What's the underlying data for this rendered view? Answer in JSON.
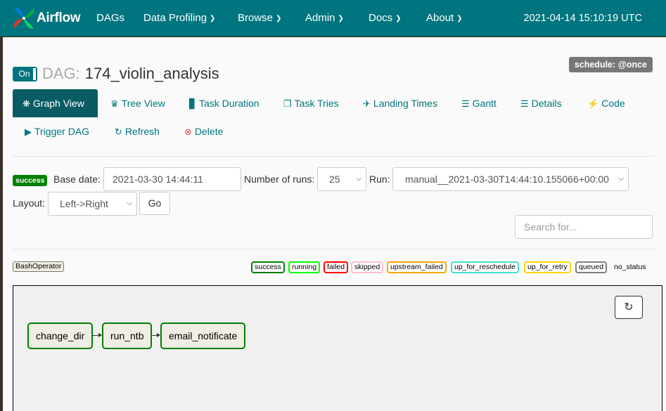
{
  "navbar": {
    "brand": "Airflow",
    "items": [
      {
        "label": "DAGs",
        "dropdown": false
      },
      {
        "label": "Data Profiling",
        "dropdown": true
      },
      {
        "label": "Browse",
        "dropdown": true
      },
      {
        "label": "Admin",
        "dropdown": true
      },
      {
        "label": "Docs",
        "dropdown": true
      },
      {
        "label": "About",
        "dropdown": true
      }
    ],
    "time": "2021-04-14 15:10:19 UTC",
    "color": "#00757f"
  },
  "dag": {
    "toggle": "On",
    "label": "DAG:",
    "name": "174_violin_analysis",
    "schedule": "schedule: @once"
  },
  "tabs": [
    {
      "label": "Graph View",
      "icon": "asterisk-icon",
      "active": true
    },
    {
      "label": "Tree View",
      "icon": "tree-icon"
    },
    {
      "label": "Task Duration",
      "icon": "bar-chart-icon"
    },
    {
      "label": "Task Tries",
      "icon": "duplicate-icon"
    },
    {
      "label": "Landing Times",
      "icon": "plane-icon"
    },
    {
      "label": "Gantt",
      "icon": "gantt-icon"
    },
    {
      "label": "Details",
      "icon": "list-icon"
    },
    {
      "label": "Code",
      "icon": "flash-icon"
    },
    {
      "label": "Trigger DAG",
      "icon": "play-circle-icon"
    },
    {
      "label": "Refresh",
      "icon": "refresh-icon"
    },
    {
      "label": "Delete",
      "icon": "remove-circle-icon"
    }
  ],
  "form": {
    "state": "success",
    "base_date_label": "Base date:",
    "base_date": "2021-03-30 14:44:11",
    "runs_label": "Number of runs:",
    "runs": "25",
    "run_label": "Run:",
    "run": "manual__2021-03-30T14:44:10.155066+00:00",
    "layout_label": "Layout:",
    "layout": "Left->Right",
    "go": "Go",
    "search_placeholder": "Search for..."
  },
  "operator": "BashOperator",
  "legend": [
    {
      "label": "success",
      "color": "#008000"
    },
    {
      "label": "running",
      "color": "#00ff00"
    },
    {
      "label": "failed",
      "color": "#ff0000"
    },
    {
      "label": "skipped",
      "color": "#ffc0cb"
    },
    {
      "label": "upstream_failed",
      "color": "#ffa500"
    },
    {
      "label": "up_for_reschedule",
      "color": "#40e0d0"
    },
    {
      "label": "up_for_retry",
      "color": "#ffd700"
    },
    {
      "label": "queued",
      "color": "#808080"
    },
    {
      "label": "no_status",
      "color": "#fafafa"
    }
  ],
  "graph": {
    "nodes": [
      "change_dir",
      "run_ntb",
      "email_notificate"
    ],
    "node_state_color": "#008000"
  }
}
